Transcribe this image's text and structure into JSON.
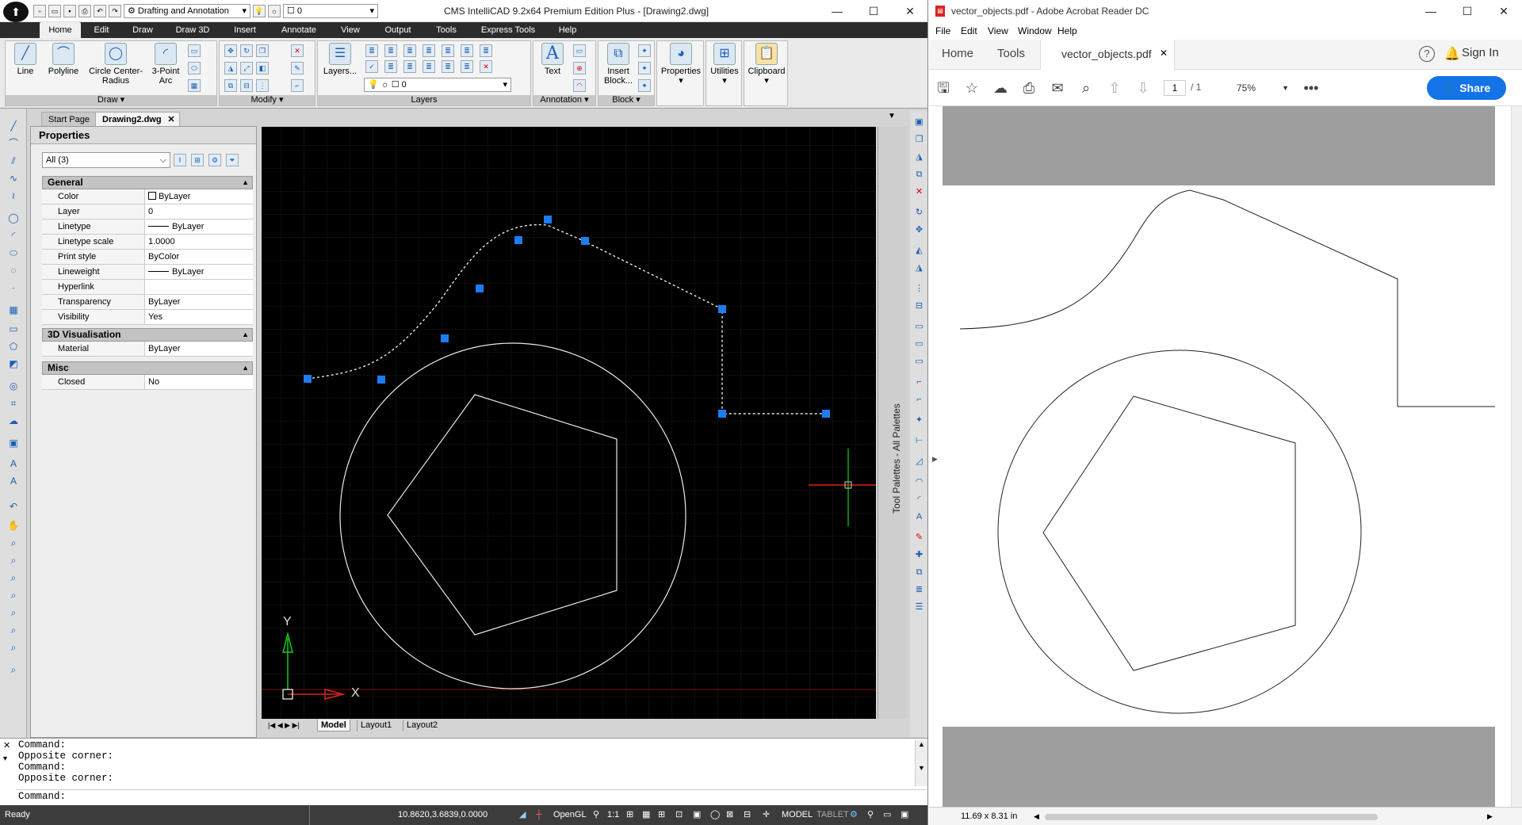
{
  "cad": {
    "window_title": "CMS IntelliCAD 9.2x64 Premium Edition Plus  - [Drawing2.dwg]",
    "workspace": "Drafting and Annotation",
    "layer_combo": "0",
    "ribbon_tabs": [
      "Home",
      "Edit",
      "Draw",
      "Draw 3D",
      "Insert",
      "Annotate",
      "View",
      "Output",
      "Tools",
      "Express Tools",
      "Help"
    ],
    "panels": {
      "draw": {
        "label": "Draw",
        "buttons": [
          "Line",
          "Polyline",
          "Circle Center-Radius",
          "3-Point Arc"
        ]
      },
      "modify": {
        "label": "Modify"
      },
      "layers": {
        "label": "Layers",
        "button": "Layers...",
        "combo": "0"
      },
      "annotation": {
        "label": "Annotation",
        "button": "Text"
      },
      "block": {
        "label": "Block",
        "button": "Insert Block..."
      },
      "properties": {
        "button": "Properties"
      },
      "utilities": {
        "button": "Utilities"
      },
      "clipboard": {
        "button": "Clipboard"
      }
    },
    "doc_tabs": [
      "Start Page",
      "Drawing2.dwg"
    ],
    "properties": {
      "title": "Properties",
      "selection": "All (3)",
      "sections": [
        {
          "name": "General",
          "rows": [
            {
              "key": "Color",
              "value": "ByLayer"
            },
            {
              "key": "Layer",
              "value": "0"
            },
            {
              "key": "Linetype",
              "value": "ByLayer"
            },
            {
              "key": "Linetype scale",
              "value": "1.0000"
            },
            {
              "key": "Print style",
              "value": "ByColor"
            },
            {
              "key": "Lineweight",
              "value": "ByLayer"
            },
            {
              "key": "Hyperlink",
              "value": ""
            },
            {
              "key": "Transparency",
              "value": "ByLayer"
            },
            {
              "key": "Visibility",
              "value": "Yes"
            }
          ]
        },
        {
          "name": "3D Visualisation",
          "rows": [
            {
              "key": "Material",
              "value": "ByLayer"
            }
          ]
        },
        {
          "name": "Misc",
          "rows": [
            {
              "key": "Closed",
              "value": "No"
            }
          ]
        }
      ]
    },
    "axis_y": "Y",
    "axis_x": "X",
    "layout_tabs": [
      "Model",
      "Layout1",
      "Layout2"
    ],
    "tool_palettes": "Tool Palettes - All Palettes",
    "command_lines": [
      "Command:",
      "Opposite corner:",
      "Command:",
      "Opposite corner:"
    ],
    "command_prompt": "Command:",
    "status": {
      "ready": "Ready",
      "coords": "10.8620,3.6839,0.0000",
      "opengl": "OpenGL",
      "scale": "1:1",
      "model": "MODEL",
      "tablet": "TABLET"
    }
  },
  "pdf": {
    "window_title": "vector_objects.pdf - Adobe Acrobat Reader DC",
    "menu": [
      "File",
      "Edit",
      "View",
      "Window",
      "Help"
    ],
    "tabs": {
      "home": "Home",
      "tools": "Tools",
      "doc": "vector_objects.pdf"
    },
    "sign_in": "Sign In",
    "page_current": "1",
    "page_total": "/ 1",
    "zoom": "75%",
    "share": "Share",
    "page_size": "11.69 x 8.31 in",
    "colors": {
      "accent": "#1473e6"
    }
  }
}
